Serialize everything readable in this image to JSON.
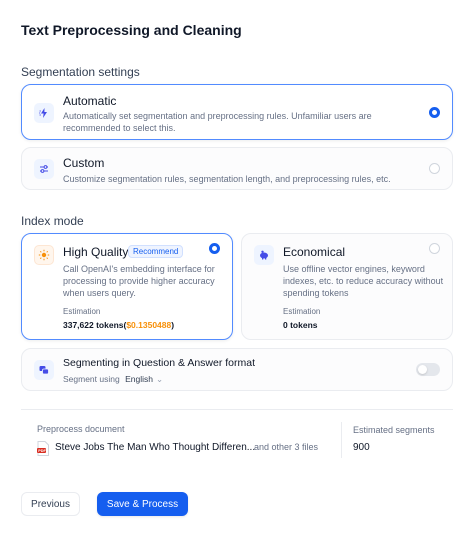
{
  "page": {
    "title": "Text Preprocessing and Cleaning"
  },
  "segmentation": {
    "section_label": "Segmentation settings",
    "automatic": {
      "title": "Automatic",
      "description": "Automatically set segmentation and preprocessing rules. Unfamiliar users are recommended to select this.",
      "selected": true
    },
    "custom": {
      "title": "Custom",
      "description": "Customize segmentation rules, segmentation length, and preprocessing rules, etc.",
      "selected": false
    }
  },
  "index_mode": {
    "section_label": "Index mode",
    "high_quality": {
      "title": "High Quality",
      "badge": "Recommend",
      "description": "Call OpenAI's embedding interface for processing to provide higher accuracy when users query.",
      "estimation_label": "Estimation",
      "estimation_tokens": "337,622 tokens(",
      "estimation_price": "$0.1350488",
      "estimation_close": ")",
      "selected": true
    },
    "economical": {
      "title": "Economical",
      "description": "Use offline vector engines, keyword indexes, etc. to reduce accuracy without spending tokens",
      "estimation_label": "Estimation",
      "estimation_value": "0 tokens",
      "selected": false
    }
  },
  "qa": {
    "title": "Segmenting in Question & Answer format",
    "using_label": "Segment using",
    "language": "English",
    "enabled": false
  },
  "preprocess": {
    "document_label": "Preprocess document",
    "file_name": "Steve Jobs The Man Who Thought Differen...",
    "other_files": "and other 3 files",
    "segments_label": "Estimated segments",
    "segments_value": "900"
  },
  "actions": {
    "previous_label": "Previous",
    "save_label": "Save & Process"
  },
  "colors": {
    "primary": "#155eef",
    "price": "#f79009",
    "pdf": "#d92d20"
  }
}
